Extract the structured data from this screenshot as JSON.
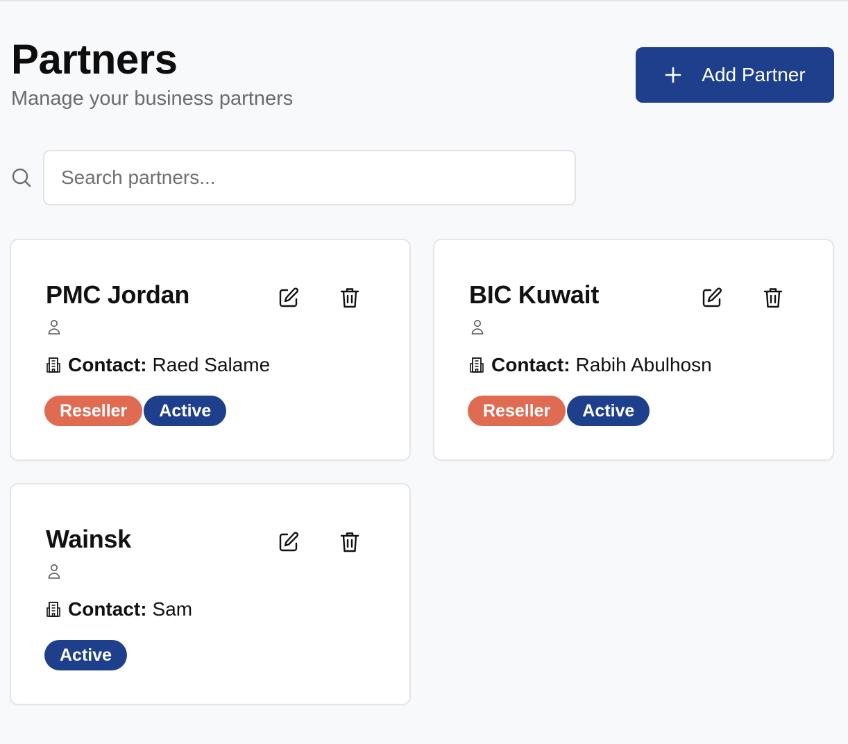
{
  "header": {
    "title": "Partners",
    "subtitle": "Manage your business partners",
    "add_button_label": "Add Partner"
  },
  "search": {
    "placeholder": "Search partners...",
    "value": ""
  },
  "colors": {
    "primary": "#1e408c",
    "reseller_badge": "#e06b53",
    "background": "#f8f9fb"
  },
  "icons": {
    "add": "plus-icon",
    "search": "search-icon",
    "edit": "edit-icon",
    "delete": "trash-icon",
    "person": "person-icon",
    "contact": "building-icon"
  },
  "partners": [
    {
      "name": "PMC Jordan",
      "contact_label": "Contact:",
      "contact_name": "Raed Salame",
      "type_badge": "Reseller",
      "status_badge": "Active"
    },
    {
      "name": "BIC Kuwait",
      "contact_label": "Contact:",
      "contact_name": "Rabih Abulhosn",
      "type_badge": "Reseller",
      "status_badge": "Active"
    },
    {
      "name": "Wainsk",
      "contact_label": "Contact:",
      "contact_name": "Sam",
      "type_badge": "",
      "status_badge": "Active"
    }
  ]
}
